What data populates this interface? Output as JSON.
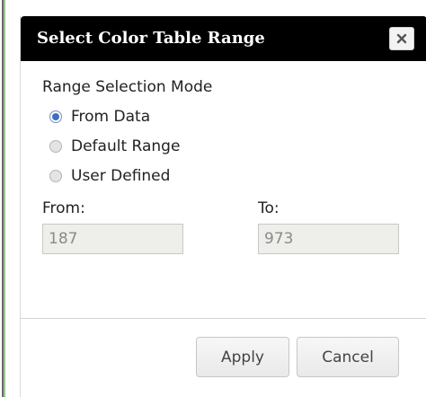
{
  "dialog": {
    "title": "Select Color Table Range",
    "close_icon": "close-x-icon",
    "range_mode": {
      "label": "Range Selection Mode",
      "options": [
        {
          "label": "From Data",
          "selected": true
        },
        {
          "label": "Default Range",
          "selected": false
        },
        {
          "label": "User Defined",
          "selected": false
        }
      ]
    },
    "from": {
      "label": "From:",
      "value": "187"
    },
    "to": {
      "label": "To:",
      "value": "973"
    },
    "buttons": {
      "apply": "Apply",
      "cancel": "Cancel"
    },
    "colors": {
      "titlebar": "#000000",
      "title_text": "#ffffff",
      "radio_selected": "#3f6fc1",
      "field_bg": "#eeeeea"
    }
  }
}
